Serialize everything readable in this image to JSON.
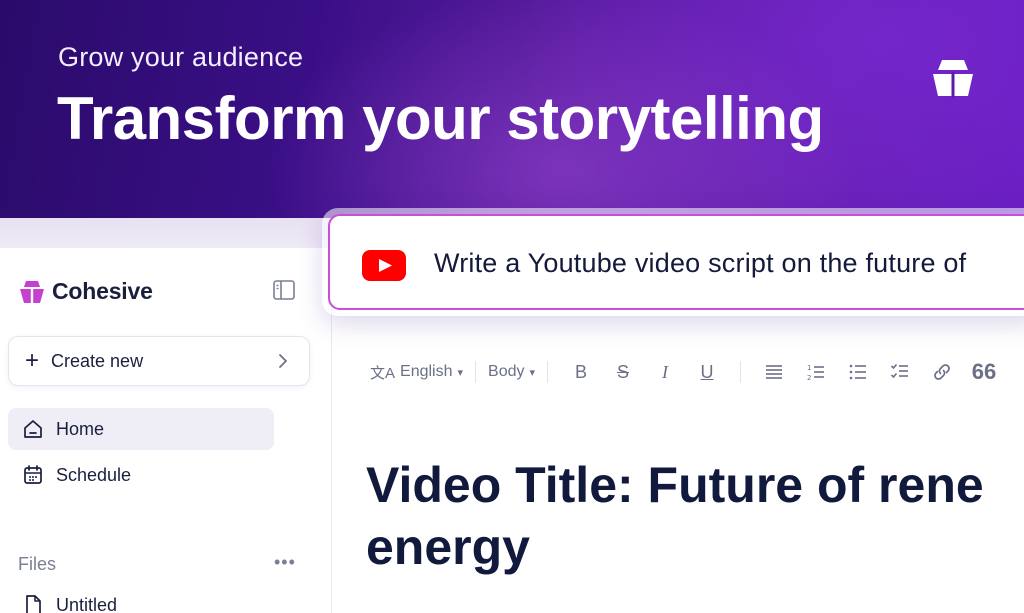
{
  "hero": {
    "subtitle": "Grow your audience",
    "title": "Transform your storytelling",
    "logo_icon": "ship-logo-icon"
  },
  "brand": {
    "name": "Cohesive",
    "logo_icon": "cohesive-logo-icon",
    "accent": "#c53fd0"
  },
  "sidebar": {
    "toggle_icon": "sidebar-toggle-icon",
    "create_new": {
      "label": "Create new",
      "icon": "plus-icon",
      "chevron": "chevron-right-icon"
    },
    "nav": [
      {
        "label": "Home",
        "icon": "home-icon",
        "active": true
      },
      {
        "label": "Schedule",
        "icon": "calendar-icon",
        "active": false
      }
    ],
    "files": {
      "heading": "Files",
      "more_icon": "more-icon",
      "items": [
        {
          "label": "Untitled",
          "icon": "file-icon"
        }
      ]
    }
  },
  "prompt": {
    "icon": "youtube-icon",
    "text": "Write a Youtube video script on the future of",
    "border_color": "#c94fd6"
  },
  "toolbar": {
    "language": "English",
    "style": "Body",
    "buttons": [
      "bold",
      "strikethrough",
      "italic",
      "underline",
      "align",
      "ordered-list",
      "bullet-list",
      "checklist",
      "link",
      "quote"
    ]
  },
  "document": {
    "title_line1": "Video Title: Future of rene",
    "title_line2": "energy"
  },
  "colors": {
    "hero_start": "#2a0b6a",
    "hero_end": "#6b1fc4",
    "text_dark": "#111a3d"
  }
}
